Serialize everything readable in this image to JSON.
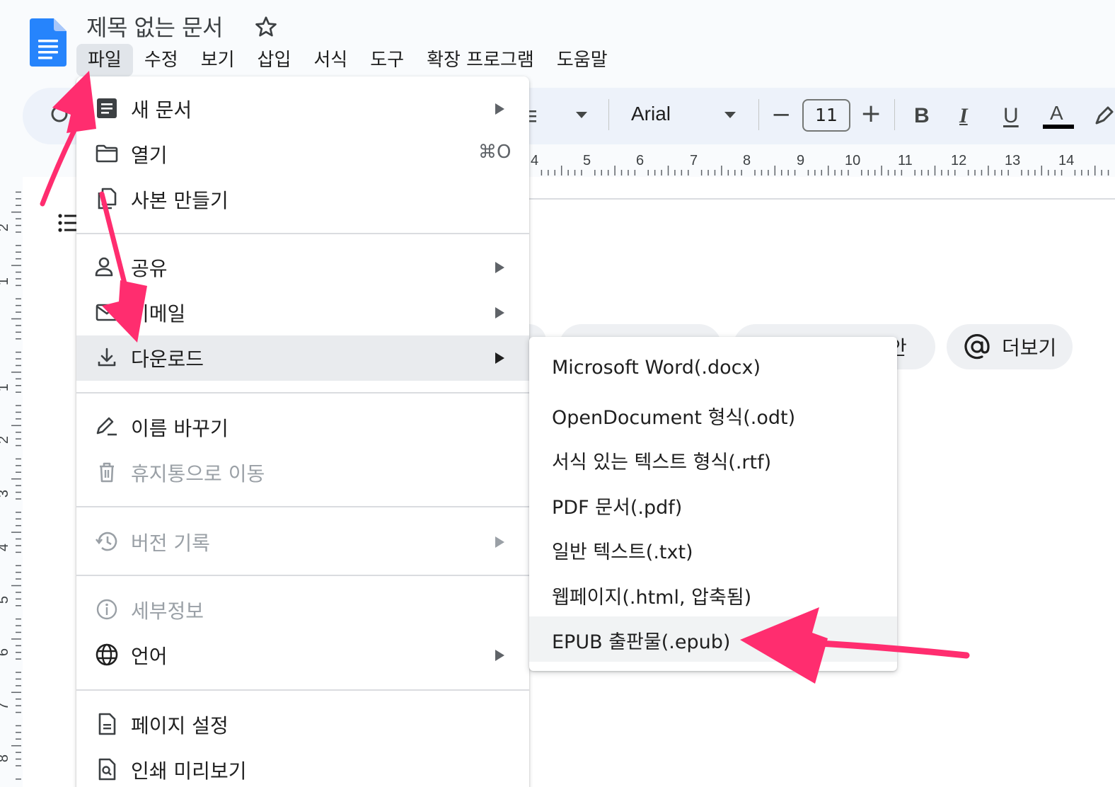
{
  "header": {
    "doc_title": "제목 없는 문서",
    "menus": [
      "파일",
      "수정",
      "보기",
      "삽입",
      "서식",
      "도구",
      "확장 프로그램",
      "도움말"
    ],
    "active_menu": "파일"
  },
  "toolbar": {
    "font": "Arial",
    "font_size": "11",
    "minus": "−",
    "plus": "+",
    "bold": "B",
    "italic": "I",
    "underline": "U",
    "text_color": "A",
    "text_color_hex": "#000000"
  },
  "ruler": {
    "horizontal": [
      "4",
      "5",
      "6",
      "7",
      "8",
      "9",
      "10",
      "11",
      "12",
      "13",
      "14"
    ],
    "vertical": [
      "2",
      "1",
      "1",
      "2",
      "3",
      "4",
      "5",
      "6",
      "7",
      "8"
    ]
  },
  "page": {
    "chip_partial_text": "안",
    "chip_more": "더보기"
  },
  "file_menu": {
    "items": [
      {
        "label": "새 문서",
        "icon": "doc-icon",
        "submenu": true
      },
      {
        "label": "열기",
        "icon": "folder-icon",
        "shortcut": "⌘O"
      },
      {
        "label": "사본 만들기",
        "icon": "copy-icon"
      },
      {
        "label": "공유",
        "icon": "person-add-icon",
        "submenu": true
      },
      {
        "label": "이메일",
        "icon": "mail-icon",
        "submenu": true
      },
      {
        "label": "다운로드",
        "icon": "download-icon",
        "submenu": true,
        "highlighted": true
      },
      {
        "label": "이름 바꾸기",
        "icon": "rename-icon"
      },
      {
        "label": "휴지통으로 이동",
        "icon": "trash-icon",
        "disabled": true
      },
      {
        "label": "버전 기록",
        "icon": "history-icon",
        "submenu": true,
        "disabled": true
      },
      {
        "label": "세부정보",
        "icon": "info-icon",
        "disabled": true
      },
      {
        "label": "언어",
        "icon": "globe-icon",
        "submenu": true
      },
      {
        "label": "페이지 설정",
        "icon": "page-setup-icon"
      },
      {
        "label": "인쇄 미리보기",
        "icon": "print-preview-icon"
      }
    ]
  },
  "download_menu": {
    "items": [
      "Microsoft Word(.docx)",
      "OpenDocument 형식(.odt)",
      "서식 있는 텍스트 형식(.rtf)",
      "PDF 문서(.pdf)",
      "일반 텍스트(.txt)",
      "웹페이지(.html, 압축됨)",
      "EPUB 출판물(.epub)"
    ],
    "highlighted": "EPUB 출판물(.epub)"
  },
  "annotation": {
    "arrow_color": "#ff2d6f"
  }
}
